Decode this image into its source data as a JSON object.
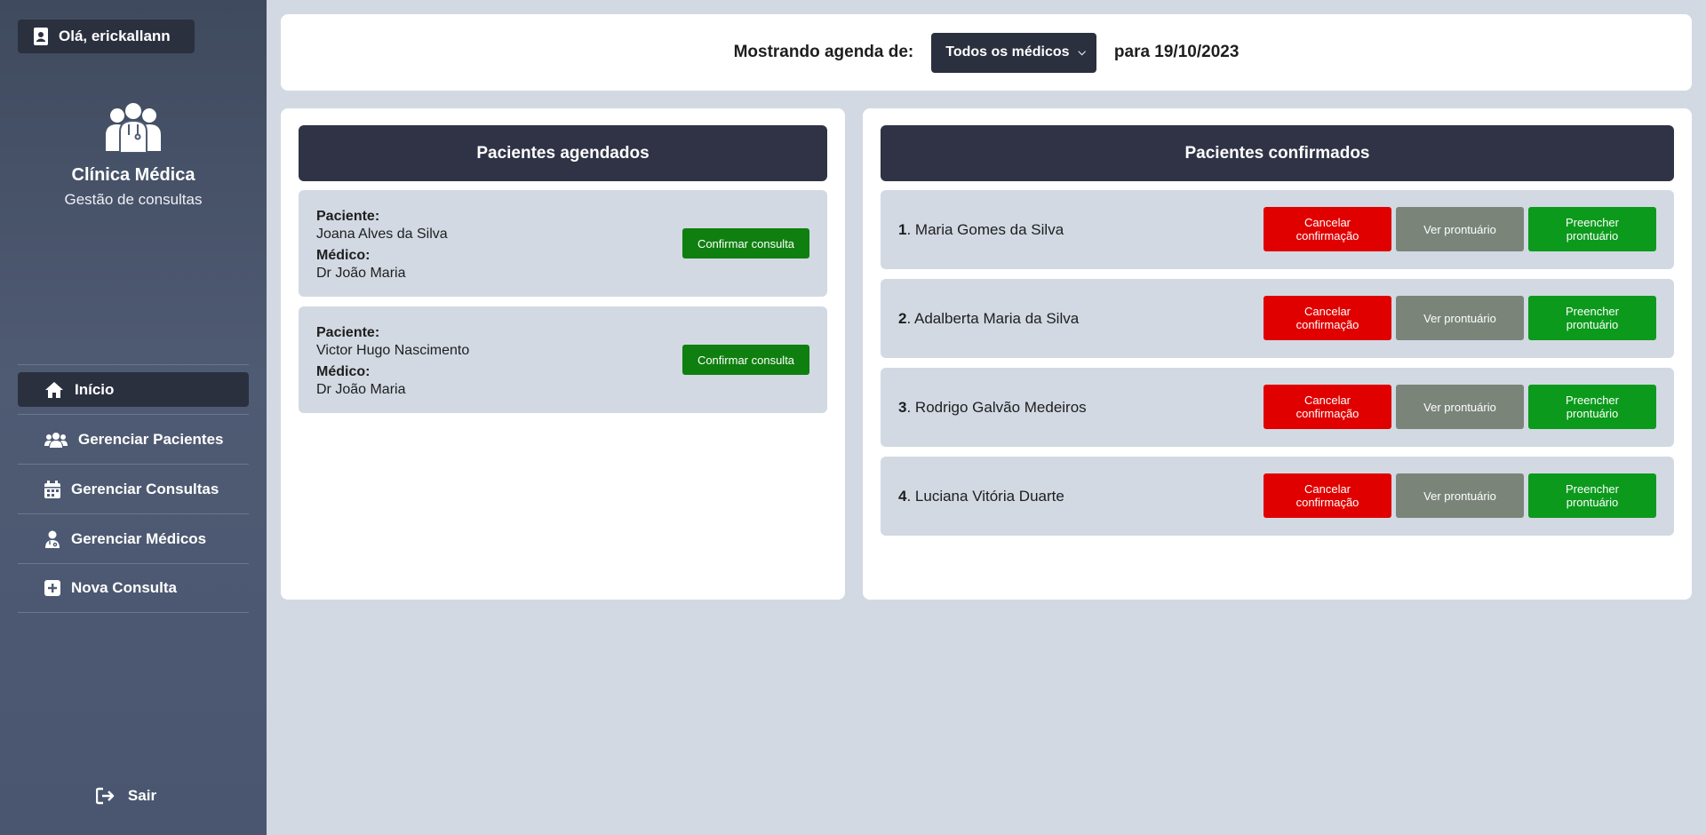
{
  "sidebar": {
    "user_greeting": "Olá, erickallann",
    "clinic_name": "Clínica Médica",
    "clinic_subtitle": "Gestão de consultas",
    "nav": [
      {
        "label": "Início",
        "icon": "home-icon",
        "active": true
      },
      {
        "label": "Gerenciar Pacientes",
        "icon": "users-icon"
      },
      {
        "label": "Gerenciar Consultas",
        "icon": "calendar-icon"
      },
      {
        "label": "Gerenciar Médicos",
        "icon": "doctor-icon"
      },
      {
        "label": "Nova Consulta",
        "icon": "plus-square-icon"
      }
    ],
    "logout_label": "Sair"
  },
  "topbar": {
    "prefix": "Mostrando agenda de:",
    "selected_doctor": "Todos os médicos",
    "date_text": "para 19/10/2023"
  },
  "scheduled": {
    "title": "Pacientes agendados",
    "patient_label": "Paciente:",
    "doctor_label": "Médico:",
    "confirm_label": "Confirmar consulta",
    "items": [
      {
        "patient": "Joana Alves da Silva",
        "doctor": "Dr João Maria"
      },
      {
        "patient": "Victor Hugo Nascimento",
        "doctor": "Dr João Maria"
      }
    ]
  },
  "confirmed": {
    "title": "Pacientes confirmados",
    "cancel_label": "Cancelar confirmação",
    "view_label": "Ver prontuário",
    "fill_label": "Preencher prontuário",
    "items": [
      {
        "num": "1",
        "name": ". Maria Gomes da Silva"
      },
      {
        "num": "2",
        "name": ". Adalberta Maria da Silva"
      },
      {
        "num": "3",
        "name": ". Rodrigo Galvão Medeiros"
      },
      {
        "num": "4",
        "name": ". Luciana Vitória Duarte"
      }
    ]
  },
  "colors": {
    "sidebar_bg": "#4a5670",
    "dark": "#2b303e",
    "danger": "#e00000",
    "neutral": "#7a8479",
    "success": "#0c9a1c"
  }
}
